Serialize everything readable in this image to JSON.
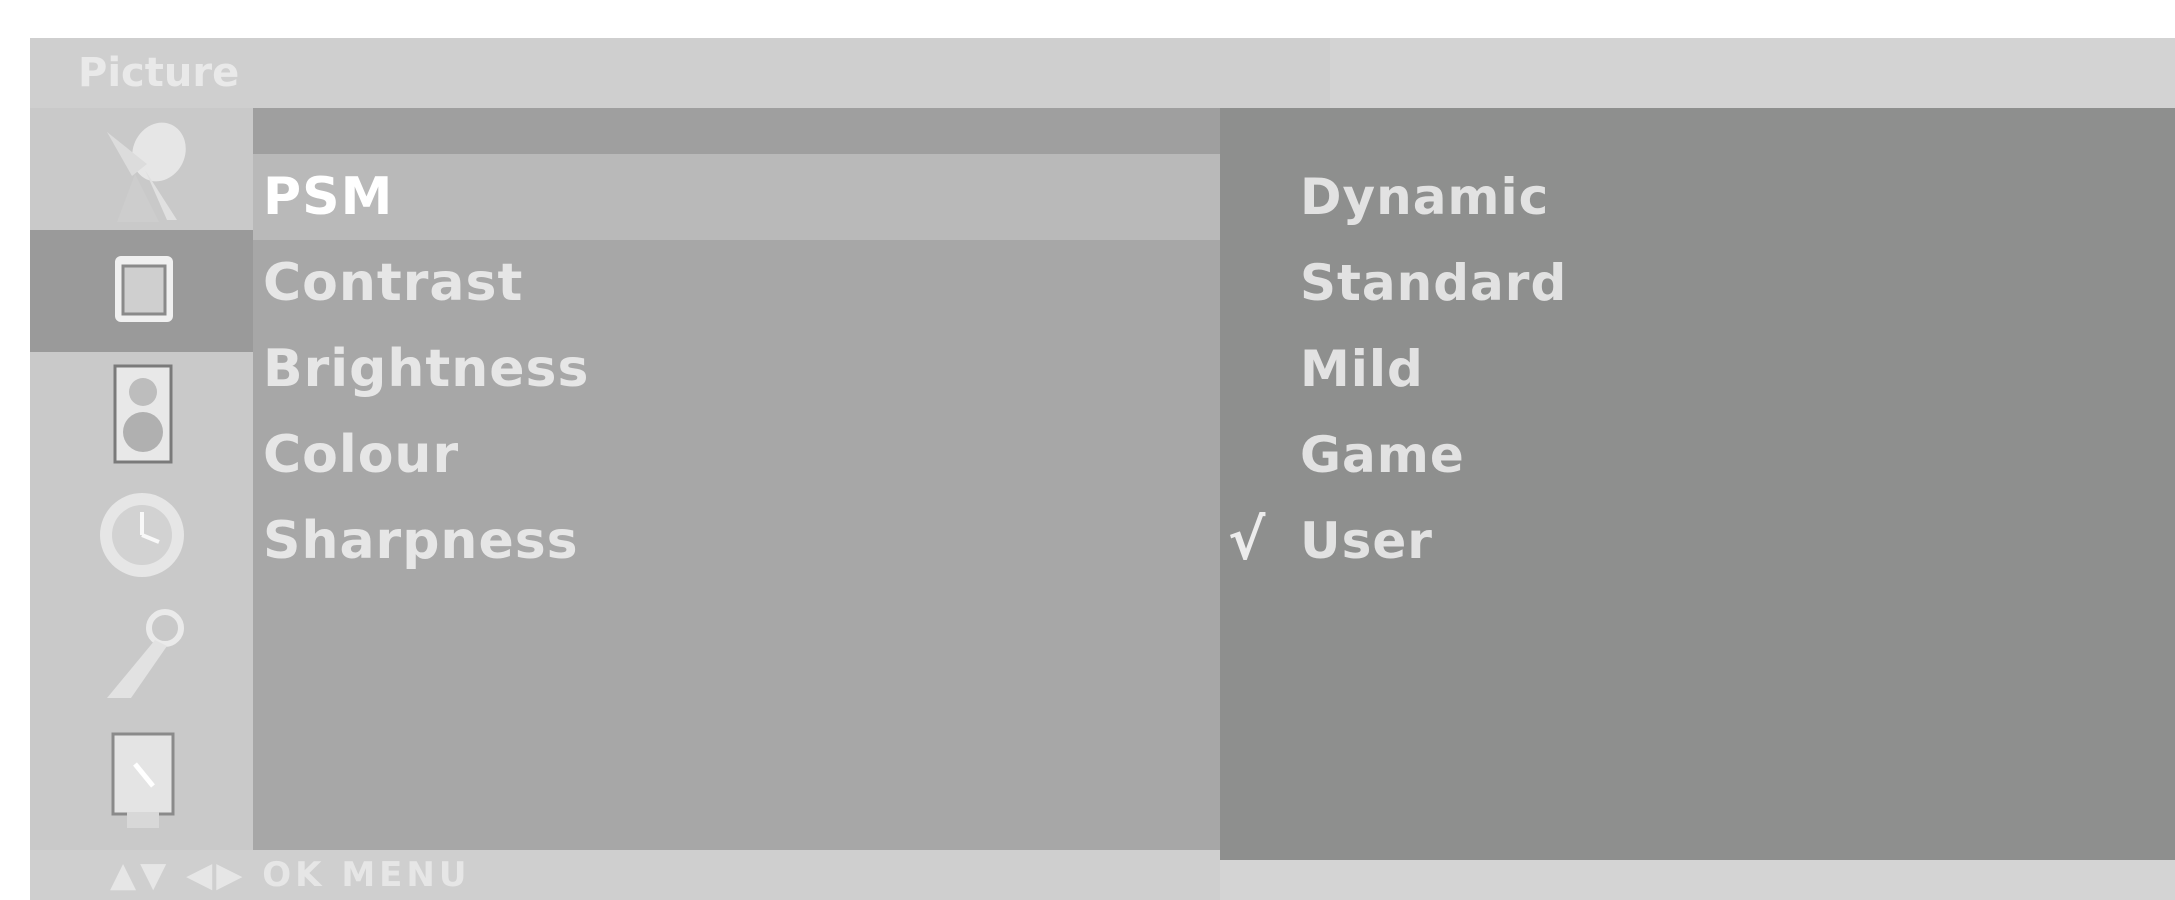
{
  "title": "Picture",
  "menu": {
    "items": [
      {
        "label": "PSM",
        "selected": true
      },
      {
        "label": "Contrast",
        "selected": false
      },
      {
        "label": "Brightness",
        "selected": false
      },
      {
        "label": "Colour",
        "selected": false
      },
      {
        "label": "Sharpness",
        "selected": false
      }
    ]
  },
  "categories": [
    {
      "icon": "satellite-dish-icon",
      "active": false
    },
    {
      "icon": "picture-icon",
      "active": true
    },
    {
      "icon": "speaker-icon",
      "active": false
    },
    {
      "icon": "clock-icon",
      "active": false
    },
    {
      "icon": "special-tool-icon",
      "active": false
    },
    {
      "icon": "screen-setup-icon",
      "active": false
    }
  ],
  "options": {
    "check_mark": "√",
    "items": [
      {
        "label": "Dynamic",
        "checked": false
      },
      {
        "label": "Standard",
        "checked": false
      },
      {
        "label": "Mild",
        "checked": false
      },
      {
        "label": "Game",
        "checked": false
      },
      {
        "label": "User",
        "checked": true
      }
    ]
  },
  "hints": "▲▼ ◀▶ OK MENU",
  "colors": {
    "menu_bg": "#a7a7a7",
    "options_bg": "#8e8f8e",
    "selected_row": "#b9b9b9",
    "active_category": "#9a9a9a"
  }
}
